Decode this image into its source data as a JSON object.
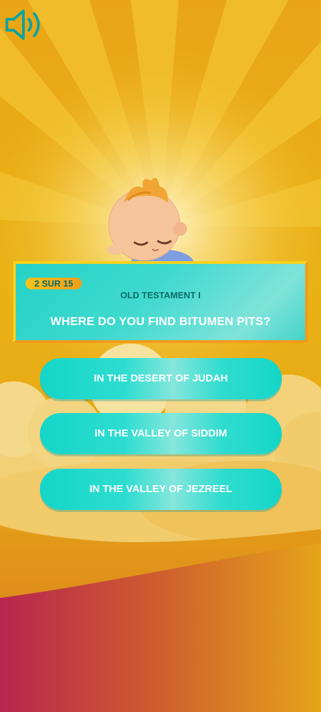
{
  "sound": {
    "icon": "speaker-icon"
  },
  "quiz": {
    "counter": "2 SUR 15",
    "category": "OLD TESTAMENT I",
    "question": "WHERE DO YOU FIND BITUMEN PITS?",
    "answers": [
      "IN THE DESERT OF JUDAH",
      "IN THE VALLEY OF SIDDIM",
      "IN THE VALLEY OF JEZREEL"
    ]
  },
  "colors": {
    "accent": "#14d6c8",
    "background_top": "#e9a516",
    "background_bottom": "#c65a32",
    "text_dark": "#0a6d68"
  }
}
